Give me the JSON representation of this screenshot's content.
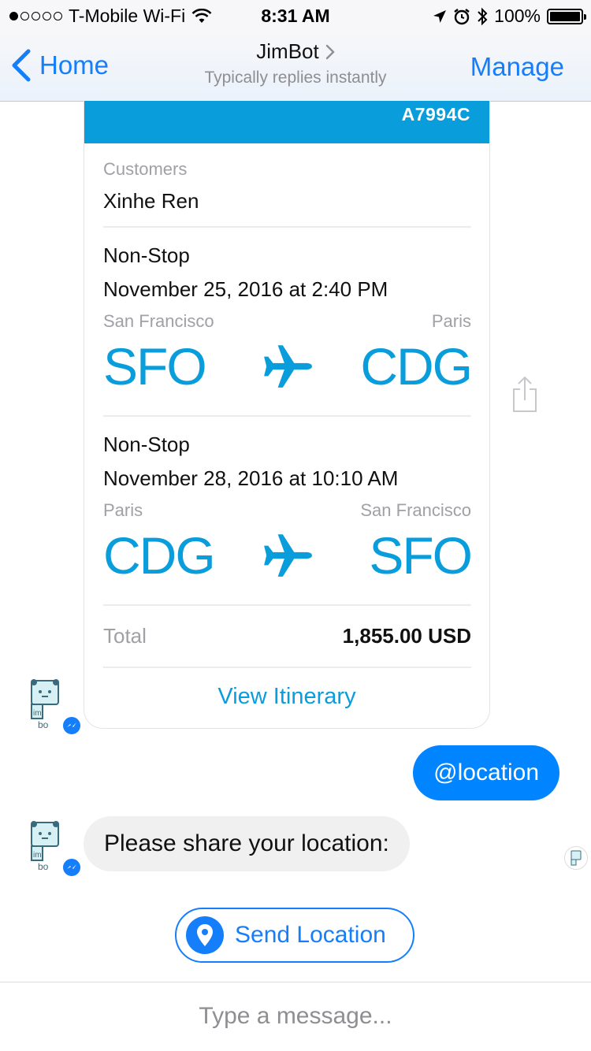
{
  "status_bar": {
    "carrier": "T-Mobile Wi-Fi",
    "time": "8:31 AM",
    "battery": "100%",
    "battery_level": 1.0,
    "signal_bars": 1,
    "icons": [
      "wifi-icon",
      "location-arrow-icon",
      "alarm-icon",
      "bluetooth-icon",
      "battery-icon"
    ]
  },
  "nav": {
    "back_label": "Home",
    "title": "JimBot",
    "subtitle": "Typically replies instantly",
    "manage_label": "Manage"
  },
  "receipt": {
    "booking_code": "A7994C",
    "customers_label": "Customers",
    "customer_name": "Xinhe Ren",
    "flights": [
      {
        "type": "Non-Stop",
        "datetime": "November 25, 2016 at 2:40 PM",
        "from_city": "San Francisco",
        "to_city": "Paris",
        "from_code": "SFO",
        "to_code": "CDG"
      },
      {
        "type": "Non-Stop",
        "datetime": "November 28, 2016 at 10:10 AM",
        "from_city": "Paris",
        "to_city": "San Francisco",
        "from_code": "CDG",
        "to_code": "SFO"
      }
    ],
    "total_label": "Total",
    "total_amount": "1,855.00 USD",
    "view_itinerary_label": "View Itinerary"
  },
  "messages": {
    "outgoing": "@location",
    "incoming": "Please share your location:",
    "send_location_label": "Send Location"
  },
  "composer": {
    "placeholder": "Type a message..."
  },
  "colors": {
    "accent": "#147efb",
    "receipt_blue": "#0a9ddb",
    "outgoing_bubble": "#0084ff",
    "incoming_bubble": "#f1f0f0"
  }
}
